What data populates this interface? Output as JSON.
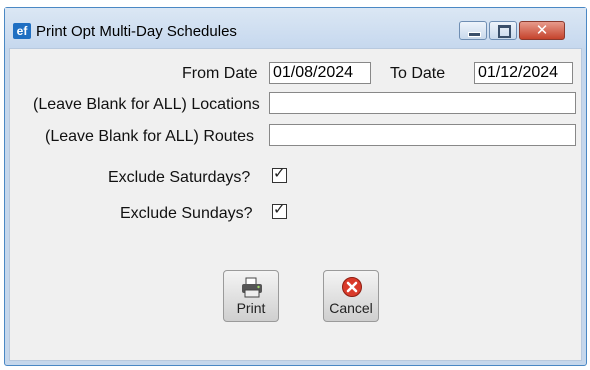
{
  "window": {
    "title": "Print Opt Multi-Day Schedules",
    "app_icon": "ef",
    "minimize_icon": "minimize-icon",
    "maximize_icon": "maximize-icon",
    "close_icon": "close-icon"
  },
  "form": {
    "from_date_label": "From Date",
    "from_date_value": "01/08/2024",
    "to_date_label": "To Date",
    "to_date_value": "01/12/2024",
    "locations_label": "(Leave Blank for ALL) Locations",
    "locations_value": "",
    "routes_label": "(Leave Blank for ALL) Routes",
    "routes_value": "",
    "exclude_saturdays_label": "Exclude Saturdays?",
    "exclude_saturdays_checked": true,
    "exclude_sundays_label": "Exclude Sundays?",
    "exclude_sundays_checked": true
  },
  "buttons": {
    "print_label": "Print",
    "print_icon": "printer-icon",
    "cancel_label": "Cancel",
    "cancel_icon": "cancel-icon"
  },
  "colors": {
    "title_bar": "#c6d8ee",
    "client_bg": "#f0f0f0",
    "close_button": "#c5432c",
    "cancel_icon": "#d93a2a"
  }
}
